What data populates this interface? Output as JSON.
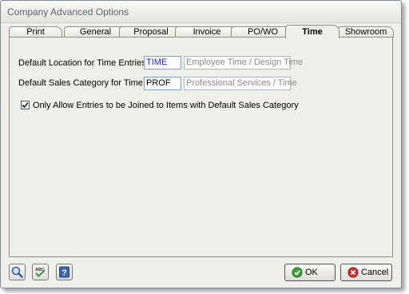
{
  "window": {
    "title": "Company Advanced Options"
  },
  "tabs": [
    {
      "label": "Print",
      "active": false
    },
    {
      "label": "General",
      "active": false
    },
    {
      "label": "Proposal",
      "active": false
    },
    {
      "label": "Invoice",
      "active": false
    },
    {
      "label": "PO/WO",
      "active": false
    },
    {
      "label": "Time",
      "active": true
    },
    {
      "label": "Showroom",
      "active": false
    }
  ],
  "form": {
    "default_location": {
      "label": "Default Location for Time Entries",
      "code": "TIME",
      "description": "Employee Time / Design Time"
    },
    "default_sales_category": {
      "label": "Default Sales Category for Time Entries",
      "code": "PROF",
      "description": "Professional Services / Time"
    },
    "only_default_category": {
      "label": "Only Allow Entries to be Joined to Items with Default Sales Category",
      "checked": true
    }
  },
  "toolbar": {
    "icons": [
      "search-icon",
      "spellcheck-icon",
      "help-icon"
    ],
    "help_glyph": "?",
    "spellcheck_glyph": "ABC",
    "ok_label": "OK",
    "cancel_label": "Cancel"
  },
  "colors": {
    "code_text": "#1a1aff",
    "ok_icon": "#3aa63a",
    "cancel_icon": "#d83030",
    "accent": "#3b66b3"
  }
}
